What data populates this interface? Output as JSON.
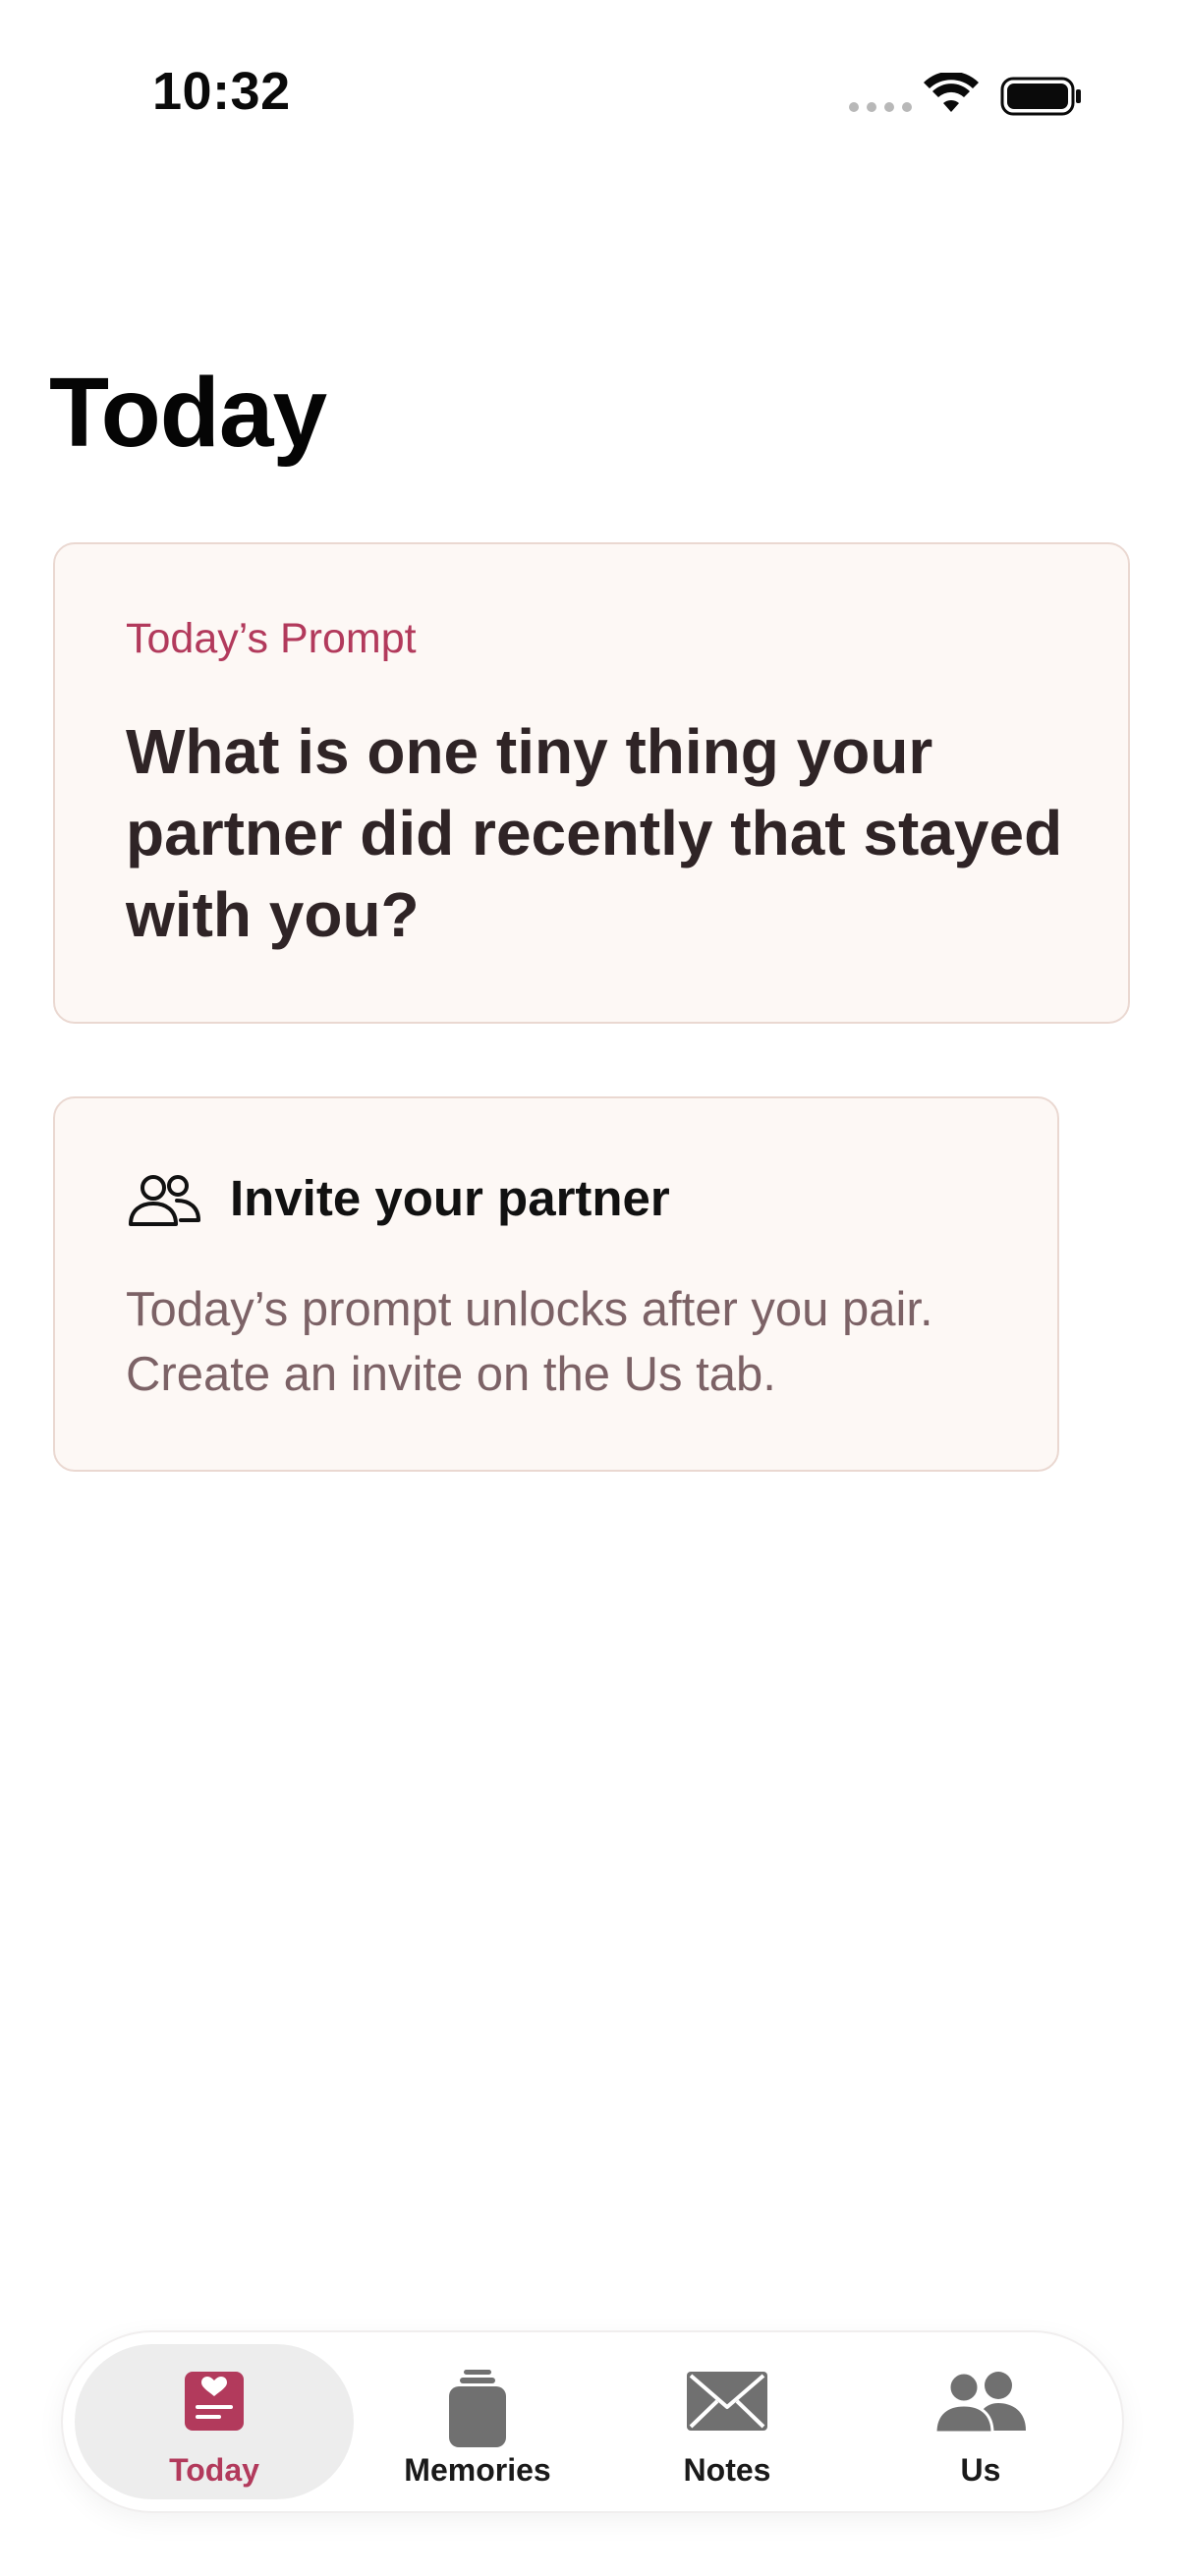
{
  "status_bar": {
    "time": "10:32"
  },
  "page": {
    "title": "Today"
  },
  "prompt_card": {
    "label": "Today’s Prompt",
    "question": "What is one tiny thing your partner did recently that stayed with you?"
  },
  "invite_card": {
    "title": "Invite your partner",
    "body": "Today’s prompt unlocks after you pair. Create an invite on the Us tab.",
    "icon": "two-people-outline-icon"
  },
  "tab_bar": {
    "selected": "Today",
    "tabs": [
      {
        "label": "Today",
        "icon": "today-heart-note-icon"
      },
      {
        "label": "Memories",
        "icon": "memories-jar-icon"
      },
      {
        "label": "Notes",
        "icon": "envelope-icon"
      },
      {
        "label": "Us",
        "icon": "two-people-icon"
      }
    ]
  },
  "colors": {
    "accent": "#b23a5c",
    "card_background": "#fdf8f5",
    "card_border": "#ead8d1",
    "muted_text": "#7c6266",
    "tab_icon": "#707070"
  }
}
